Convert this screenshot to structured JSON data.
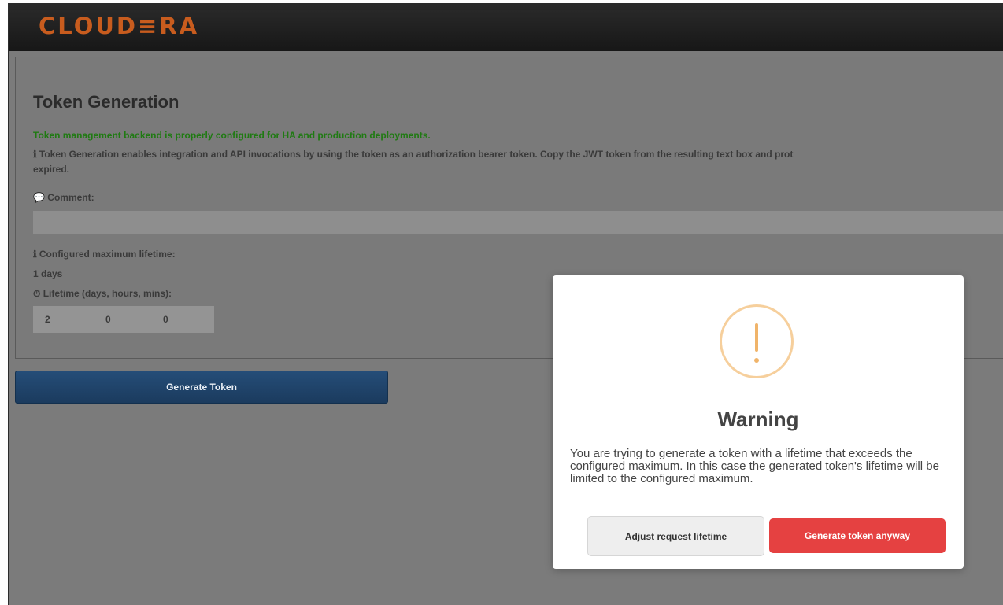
{
  "brand": {
    "logo_text": "CLOUD≡RA",
    "color": "#c85c1e"
  },
  "page": {
    "title": "Token Generation",
    "status_success": "Token management backend is properly configured for HA and production deployments.",
    "info_text": "ℹ Token Generation enables integration and API invocations by using the token as an authorization bearer token. Copy the JWT token from the resulting text box and prot",
    "info_text_cont": "expired.",
    "comment_label": "💬 Comment:",
    "comment_value": "",
    "max_lifetime_label": "ℹ Configured maximum lifetime:",
    "max_lifetime_value": "1 days",
    "lifetime_label": "⏱ Lifetime (days, hours, mins):",
    "lifetime": {
      "days": "2",
      "hours": "0",
      "mins": "0"
    },
    "generate_button": "Generate Token"
  },
  "modal": {
    "icon": "exclamation-circle-icon",
    "title": "Warning",
    "message": "You are trying to generate a token with a lifetime that exceeds the configured maximum. In this case the generated token's lifetime will be limited to the configured maximum.",
    "adjust_button": "Adjust request lifetime",
    "confirm_button": "Generate token anyway",
    "colors": {
      "warning": "#f6cf9c",
      "confirm": "#e54141"
    }
  }
}
